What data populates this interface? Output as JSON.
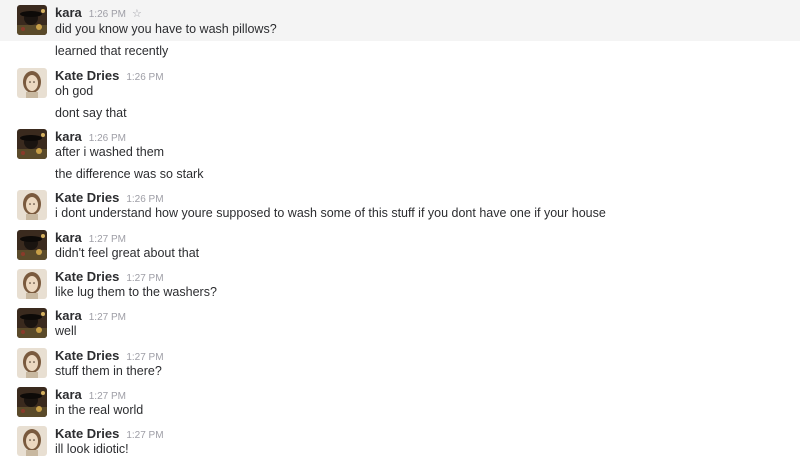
{
  "messages": [
    {
      "author": "kara",
      "time": "1:26 PM",
      "avatar": "kara-avatar",
      "lines": [
        "did you know you have to wash pillows?",
        "learned that recently"
      ]
    },
    {
      "author": "Kate Dries",
      "time": "1:26 PM",
      "avatar": "kate-avatar",
      "lines": [
        "oh god",
        "dont say that"
      ]
    },
    {
      "author": "kara",
      "time": "1:26 PM",
      "avatar": "kara-avatar",
      "lines": [
        "after i washed them",
        "the difference was so stark"
      ]
    },
    {
      "author": "Kate Dries",
      "time": "1:26 PM",
      "avatar": "kate-avatar",
      "lines": [
        "i dont understand how youre supposed to wash some of this stuff if you dont have one if your house"
      ]
    },
    {
      "author": "kara",
      "time": "1:27 PM",
      "avatar": "kara-avatar",
      "lines": [
        "didn't feel great about that"
      ]
    },
    {
      "author": "Kate Dries",
      "time": "1:27 PM",
      "avatar": "kate-avatar",
      "lines": [
        "like lug them to the washers?"
      ]
    },
    {
      "author": "kara",
      "time": "1:27 PM",
      "avatar": "kara-avatar",
      "lines": [
        "well"
      ]
    },
    {
      "author": "Kate Dries",
      "time": "1:27 PM",
      "avatar": "kate-avatar",
      "lines": [
        "stuff them in there?"
      ]
    },
    {
      "author": "kara",
      "time": "1:27 PM",
      "avatar": "kara-avatar",
      "lines": [
        "in the real world"
      ]
    },
    {
      "author": "Kate Dries",
      "time": "1:27 PM",
      "avatar": "kate-avatar",
      "lines": [
        "ill look idiotic!"
      ]
    }
  ],
  "star_icon": "star-icon",
  "colors": {
    "hover_background": "#f4f4f4",
    "text": "#2c2d30",
    "timestamp": "#9e9ea6"
  }
}
